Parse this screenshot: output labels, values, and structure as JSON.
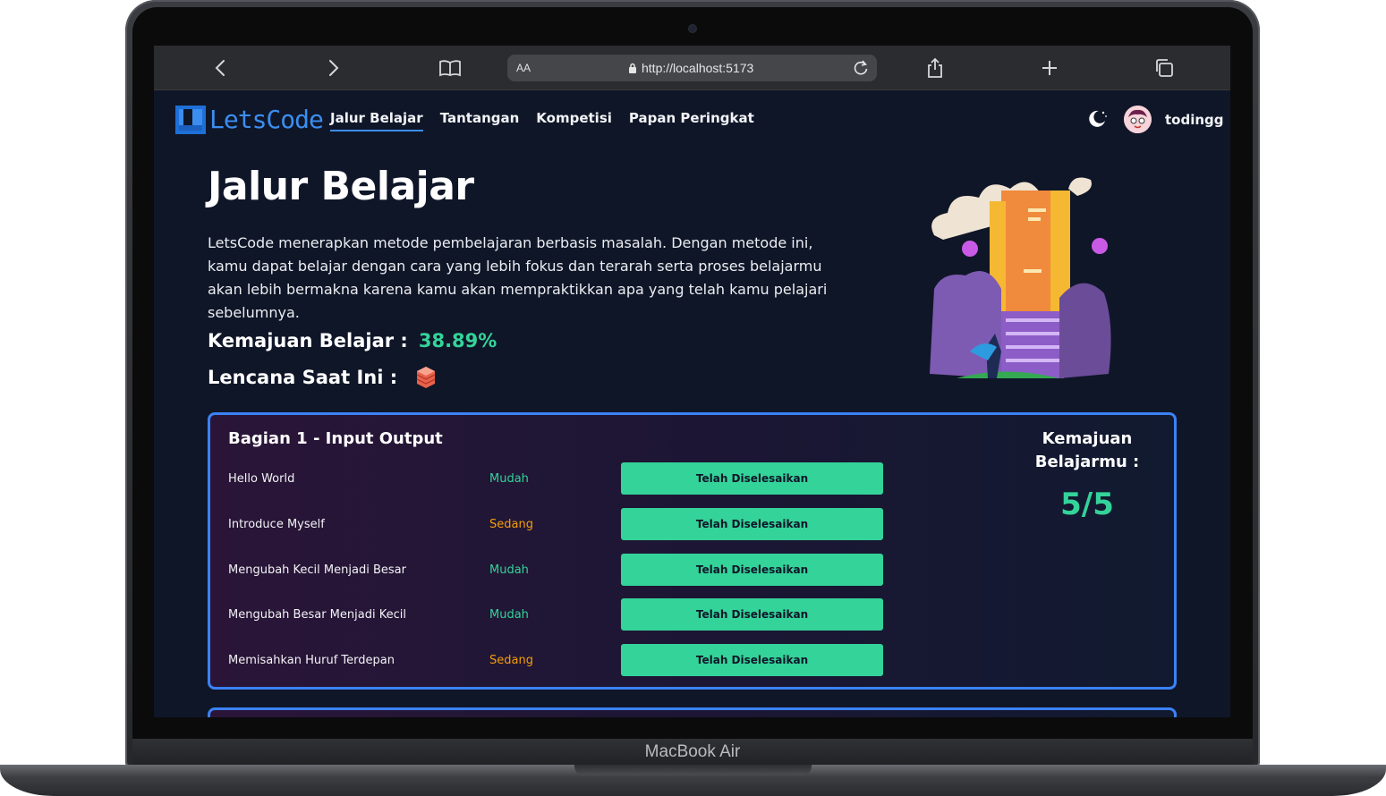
{
  "device": {
    "label": "MacBook Air"
  },
  "browser": {
    "text_size_label": "AA",
    "url": "http://localhost:5173"
  },
  "nav": {
    "logo_text": "LetsCode",
    "links": [
      "Jalur Belajar",
      "Tantangan",
      "Kompetisi",
      "Papan Peringkat"
    ],
    "active_link": "Jalur Belajar",
    "username": "todingg"
  },
  "hero": {
    "title": "Jalur Belajar",
    "intro": "LetsCode menerapkan metode pembelajaran berbasis masalah. Dengan metode ini, kamu dapat belajar dengan cara yang lebih fokus dan terarah serta proses belajarmu akan lebih bermakna karena kamu akan mempraktikkan apa yang telah kamu pelajari sebelumnya.",
    "progress_label": "Kemajuan Belajar :",
    "progress_value": "38.89%",
    "badge_label": "Lencana Saat Ini :"
  },
  "sections": [
    {
      "title": "Bagian 1 - Input Output",
      "progress_label": "Kemajuan Belajarmu :",
      "progress_value": "5/5",
      "lessons": [
        {
          "name": "Hello World",
          "level": "Mudah",
          "status": "Telah Diselesaikan"
        },
        {
          "name": "Introduce Myself",
          "level": "Sedang",
          "status": "Telah Diselesaikan"
        },
        {
          "name": "Mengubah Kecil Menjadi Besar",
          "level": "Mudah",
          "status": "Telah Diselesaikan"
        },
        {
          "name": "Mengubah Besar Menjadi Kecil",
          "level": "Mudah",
          "status": "Telah Diselesaikan"
        },
        {
          "name": "Memisahkan Huruf Terdepan",
          "level": "Sedang",
          "status": "Telah Diselesaikan"
        }
      ]
    }
  ],
  "colors": {
    "accent_blue": "#3b82f6",
    "success_green": "#34d399",
    "medium_orange": "#f59e0b",
    "background": "#0f1628"
  },
  "icons": [
    "chevron-left-icon",
    "chevron-right-icon",
    "book-icon",
    "lock-icon",
    "reload-icon",
    "share-icon",
    "plus-icon",
    "tabs-icon",
    "moon-icon",
    "badge-icon"
  ]
}
